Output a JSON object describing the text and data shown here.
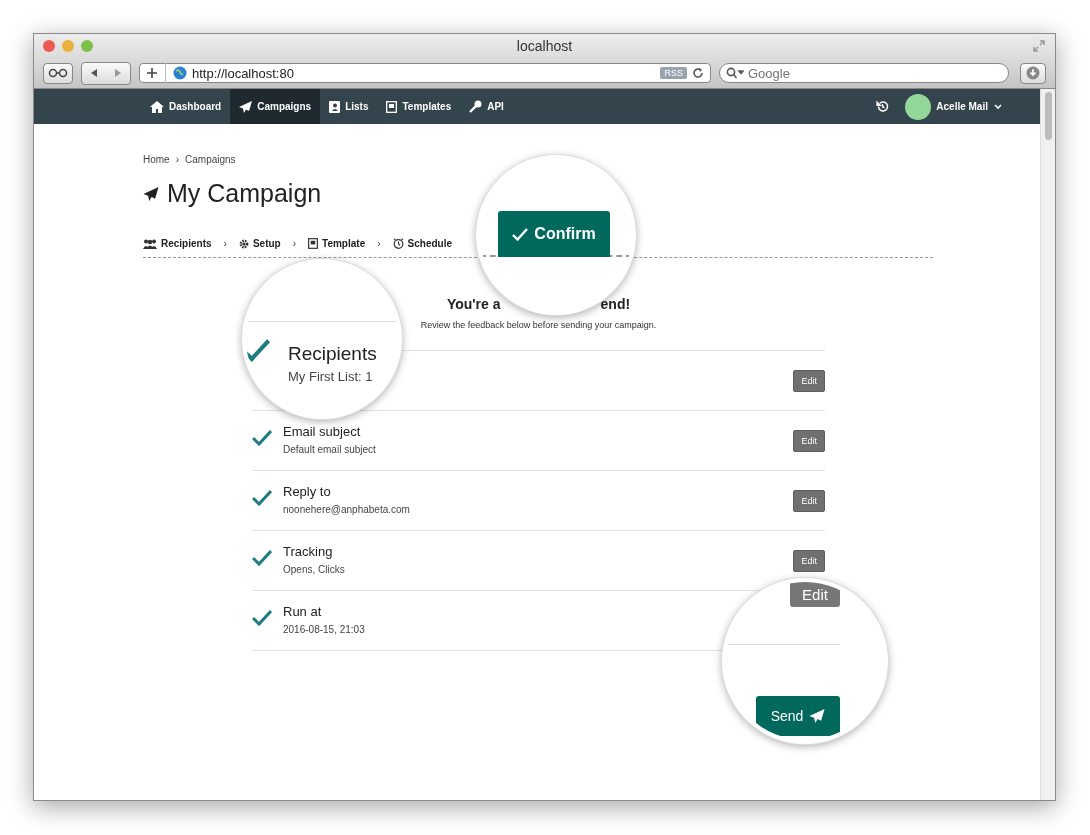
{
  "window": {
    "title": "localhost"
  },
  "toolbar": {
    "url": "http://localhost:80",
    "rss_badge": "RSS",
    "search": {
      "placeholder": "Google"
    }
  },
  "nav": {
    "items": [
      {
        "label": "Dashboard",
        "selected": false
      },
      {
        "label": "Campaigns",
        "selected": true
      },
      {
        "label": "Lists",
        "selected": false
      },
      {
        "label": "Templates",
        "selected": false
      },
      {
        "label": "API",
        "selected": false
      }
    ],
    "user": {
      "name": "Acelle Mail"
    }
  },
  "breadcrumb": {
    "separator": "›",
    "items": [
      "Home",
      "Campaigns"
    ]
  },
  "page_title": "My Campaign",
  "steps": {
    "separator": "›",
    "items": [
      "Recipients",
      "Setup",
      "Template",
      "Schedule"
    ]
  },
  "review": {
    "heading_parts": [
      "You're a",
      "end!"
    ],
    "subtitle": "Review the feedback below before sending your campaign.",
    "rows": [
      {
        "edit": "Edit"
      },
      {
        "title": "Email subject",
        "detail": "Default email subject",
        "done": true,
        "edit": "Edit"
      },
      {
        "title": "Reply to",
        "detail": "noonehere@anphabeta.com",
        "done": true,
        "edit": "Edit"
      },
      {
        "title": "Tracking",
        "detail": "Opens, Clicks",
        "done": true,
        "edit": "Edit"
      },
      {
        "title": "Run at",
        "detail": "2016-08-15, 21:03",
        "done": true
      }
    ]
  },
  "magnifiers": [
    {
      "kind": "step",
      "button": "Confirm"
    },
    {
      "kind": "row",
      "title": "Recipients",
      "detail": "My First List: 1",
      "done": true
    },
    {
      "kind": "send",
      "edit": "Edit",
      "button": "Send"
    }
  ]
}
